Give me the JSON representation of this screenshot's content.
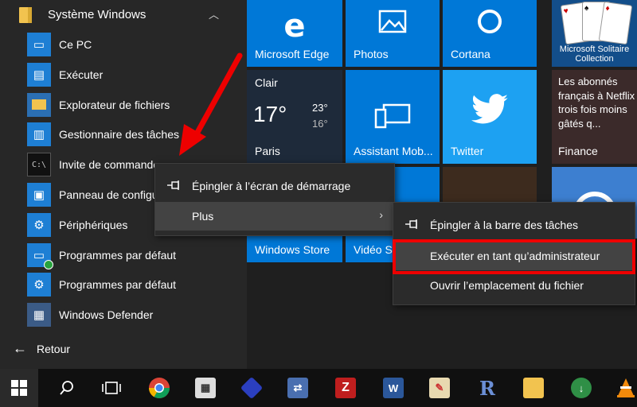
{
  "left_pane": {
    "group_title": "Système Windows",
    "items": [
      {
        "label": "Ce PC"
      },
      {
        "label": "Exécuter"
      },
      {
        "label": "Explorateur de fichiers"
      },
      {
        "label": "Gestionnaire des tâches"
      },
      {
        "label": "Invite de commandes"
      },
      {
        "label": "Panneau de configuration"
      },
      {
        "label": "Périphériques"
      },
      {
        "label": "Programmes par défaut"
      },
      {
        "label": "Programmes par défaut"
      },
      {
        "label": "Windows Defender"
      }
    ],
    "back_label": "Retour"
  },
  "tiles": {
    "edge": "Microsoft Edge",
    "photos": "Photos",
    "cortana": "Cortana",
    "solitaire": "Microsoft Solitaire Collection",
    "weather": {
      "condition": "Clair",
      "temp": "17°",
      "high": "23°",
      "low": "16°",
      "city": "Paris"
    },
    "assistant": "Assistant Mob...",
    "twitter": "Twitter",
    "news": {
      "headline": "Les abonnés français à Netflix trois fois moins gâtés q...",
      "source": "Finance"
    },
    "store": "Windows Store",
    "video": "Vidéo Sl..."
  },
  "context_menu": {
    "pin_start": "Épingler à l’écran de démarrage",
    "more": "Plus"
  },
  "submenu": {
    "pin_taskbar": "Épingler à la barre des tâches",
    "run_admin": "Exécuter en tant qu’administrateur",
    "open_location": "Ouvrir l’emplacement du fichier"
  },
  "colors": {
    "accent": "#0078d7",
    "highlight": "#e00000",
    "twitter": "#1da1f2"
  }
}
